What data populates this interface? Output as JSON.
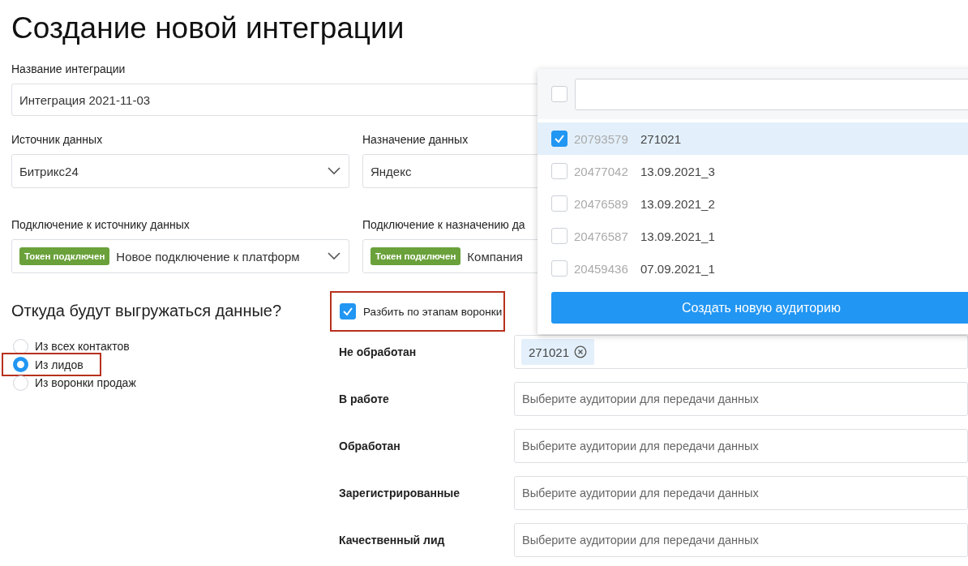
{
  "title": "Создание новой интеграции",
  "name_field": {
    "label": "Название интеграции",
    "value": "Интеграция 2021-11-03"
  },
  "source": {
    "label": "Источник данных",
    "value": "Битрикс24"
  },
  "destination": {
    "label": "Назначение данных",
    "value": "Яндекс"
  },
  "source_connection": {
    "label": "Подключение к источнику данных",
    "badge": "Токен подключен",
    "value": "Новое подключение к платформ"
  },
  "destination_connection": {
    "label": "Подключение к назначению да",
    "badge": "Токен подключен",
    "value": "Компания"
  },
  "export_source": {
    "heading": "Откуда будут выгружаться данные?",
    "options": [
      {
        "label": "Из всех контактов",
        "selected": false,
        "highlighted": false
      },
      {
        "label": "Из лидов",
        "selected": true,
        "highlighted": true
      },
      {
        "label": "Из воронки продаж",
        "selected": false,
        "highlighted": false
      }
    ]
  },
  "split_by_stages": {
    "label": "Разбить по этапам воронки",
    "checked": true,
    "highlighted": true
  },
  "stages": [
    {
      "label": "Не обработан",
      "tags": [
        "271021"
      ]
    },
    {
      "label": "В работе",
      "placeholder": "Выберите аудитории для передачи данных"
    },
    {
      "label": "Обработан",
      "placeholder": "Выберите аудитории для передачи данных"
    },
    {
      "label": "Зарегистрированные",
      "placeholder": "Выберите аудитории для передачи данных"
    },
    {
      "label": "Качественный лид",
      "placeholder": "Выберите аудитории для передачи данных"
    }
  ],
  "audience_dropdown": {
    "select_all_checked": false,
    "items": [
      {
        "id": "20793579",
        "name": "271021",
        "checked": true
      },
      {
        "id": "20477042",
        "name": "13.09.2021_3",
        "checked": false
      },
      {
        "id": "20476589",
        "name": "13.09.2021_2",
        "checked": false
      },
      {
        "id": "20476587",
        "name": "13.09.2021_1",
        "checked": false
      },
      {
        "id": "20459436",
        "name": "07.09.2021_1",
        "checked": false
      }
    ],
    "button": "Создать новую аудиторию"
  }
}
